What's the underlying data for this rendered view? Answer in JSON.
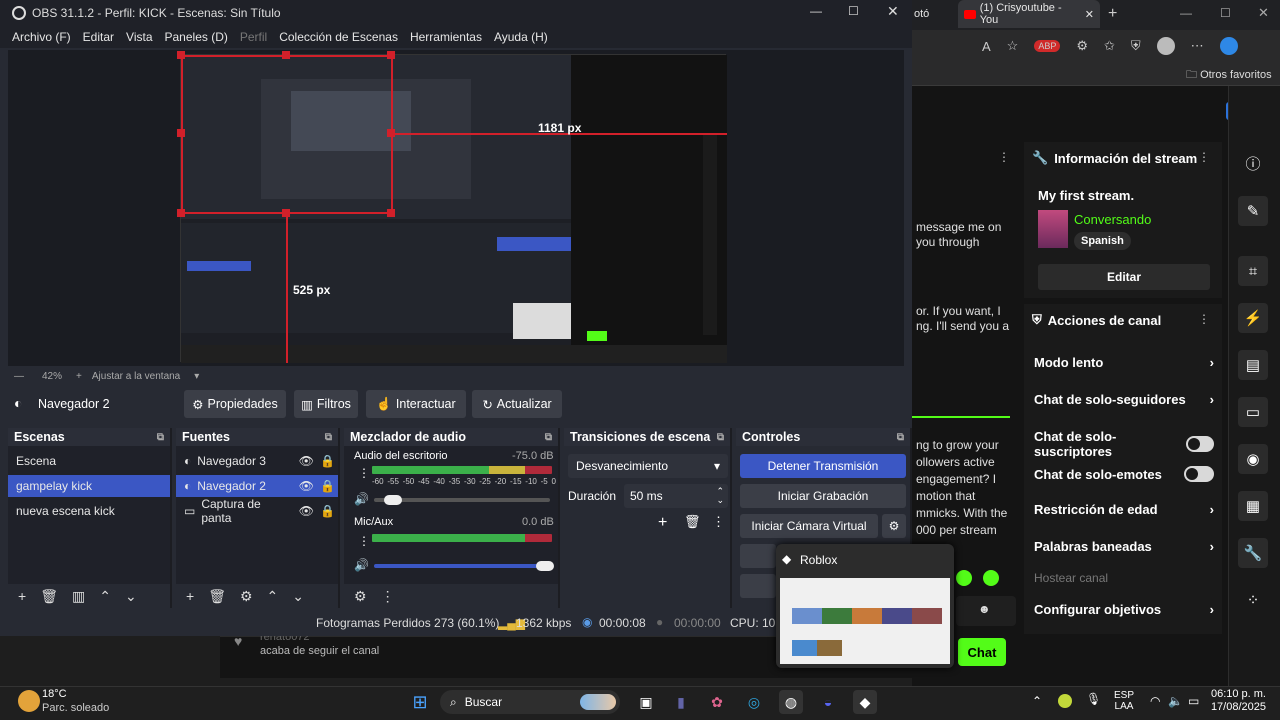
{
  "obs": {
    "title": "OBS 31.1.2 - Perfil: KICK - Escenas: Sin Título",
    "menu": [
      "Archivo (F)",
      "Editar",
      "Vista",
      "Paneles (D)",
      "Perfil",
      "Colección de Escenas",
      "Herramientas",
      "Ayuda (H)"
    ],
    "preview": {
      "width_label": "1181 px",
      "height_label": "525 px",
      "zoom": "42%",
      "fit_label": "Ajustar a la ventana"
    },
    "source_selected": "Navegador 2",
    "prop_buttons": {
      "properties": "Propiedades",
      "filters": "Filtros",
      "interact": "Interactuar",
      "refresh": "Actualizar"
    },
    "docks": {
      "scenes_title": "Escenas",
      "scenes": [
        "Escena",
        "gampelay kick",
        "nueva escena kick"
      ],
      "sources_title": "Fuentes",
      "sources": [
        "Navegador 3",
        "Navegador 2",
        "Captura de panta"
      ],
      "mixer_title": "Mezclador de audio",
      "mixer": [
        {
          "name": "Audio del escritorio",
          "db": "-75.0 dB"
        },
        {
          "name": "Mic/Aux",
          "db": "0.0 dB"
        }
      ],
      "meter_ticks": [
        "-60",
        "-55",
        "-50",
        "-45",
        "-40",
        "-35",
        "-30",
        "-25",
        "-20",
        "-15",
        "-10",
        "-5",
        "0"
      ],
      "transitions_title": "Transiciones de escena",
      "transition": "Desvanecimiento",
      "duration_label": "Duración",
      "duration_value": "50 ms",
      "controls_title": "Controles",
      "controls": [
        "Detener Transmisión",
        "Iniciar Grabación",
        "Iniciar Cámara Virtual"
      ]
    },
    "status": {
      "dropped": "Fotogramas Perdidos 273 (60.1%)",
      "bitrate": "1362 kbps",
      "time1": "00:00:08",
      "time2": "00:00:00",
      "cpu": "CPU: 10.7"
    }
  },
  "browser": {
    "tabs": [
      "(1) Crisyoutube - You",
      "otó"
    ],
    "bookmarks": "Otros favoritos",
    "colors": {
      "kick_green": "#53fc18",
      "obs_select": "#3b57c4",
      "red_bound": "#d2202a"
    }
  },
  "kick": {
    "chat_snippets": [
      "message me on",
      "you through",
      "or. If you want, I",
      "ng. I'll send you a",
      "ng to grow your",
      "ollowers active",
      "engagement? I",
      "motion that",
      "mmicks. With the",
      "000 per stream"
    ],
    "follow_notice": "acaba de seguir el canal",
    "follow_user": "renato072",
    "stream_info_title": "Información del stream",
    "stream_title": "My first stream.",
    "category": "Conversando",
    "language": "Spanish",
    "edit": "Editar",
    "actions_title": "Acciones de canal",
    "actions": [
      "Modo lento",
      "Chat de solo-seguidores",
      "Chat de solo-suscriptores",
      "Chat de solo-emotes",
      "Restricción de edad",
      "Palabras baneadas",
      "Hostear canal",
      "Configurar objetivos"
    ],
    "chat_button": "Chat"
  },
  "preview_popup": {
    "title": "Roblox"
  },
  "taskbar": {
    "weather_temp": "18°C",
    "weather_desc": "Parc. soleado",
    "search": "Buscar",
    "lang1": "ESP",
    "lang2": "LAA",
    "time": "06:10 p. m.",
    "date": "17/08/2025"
  }
}
